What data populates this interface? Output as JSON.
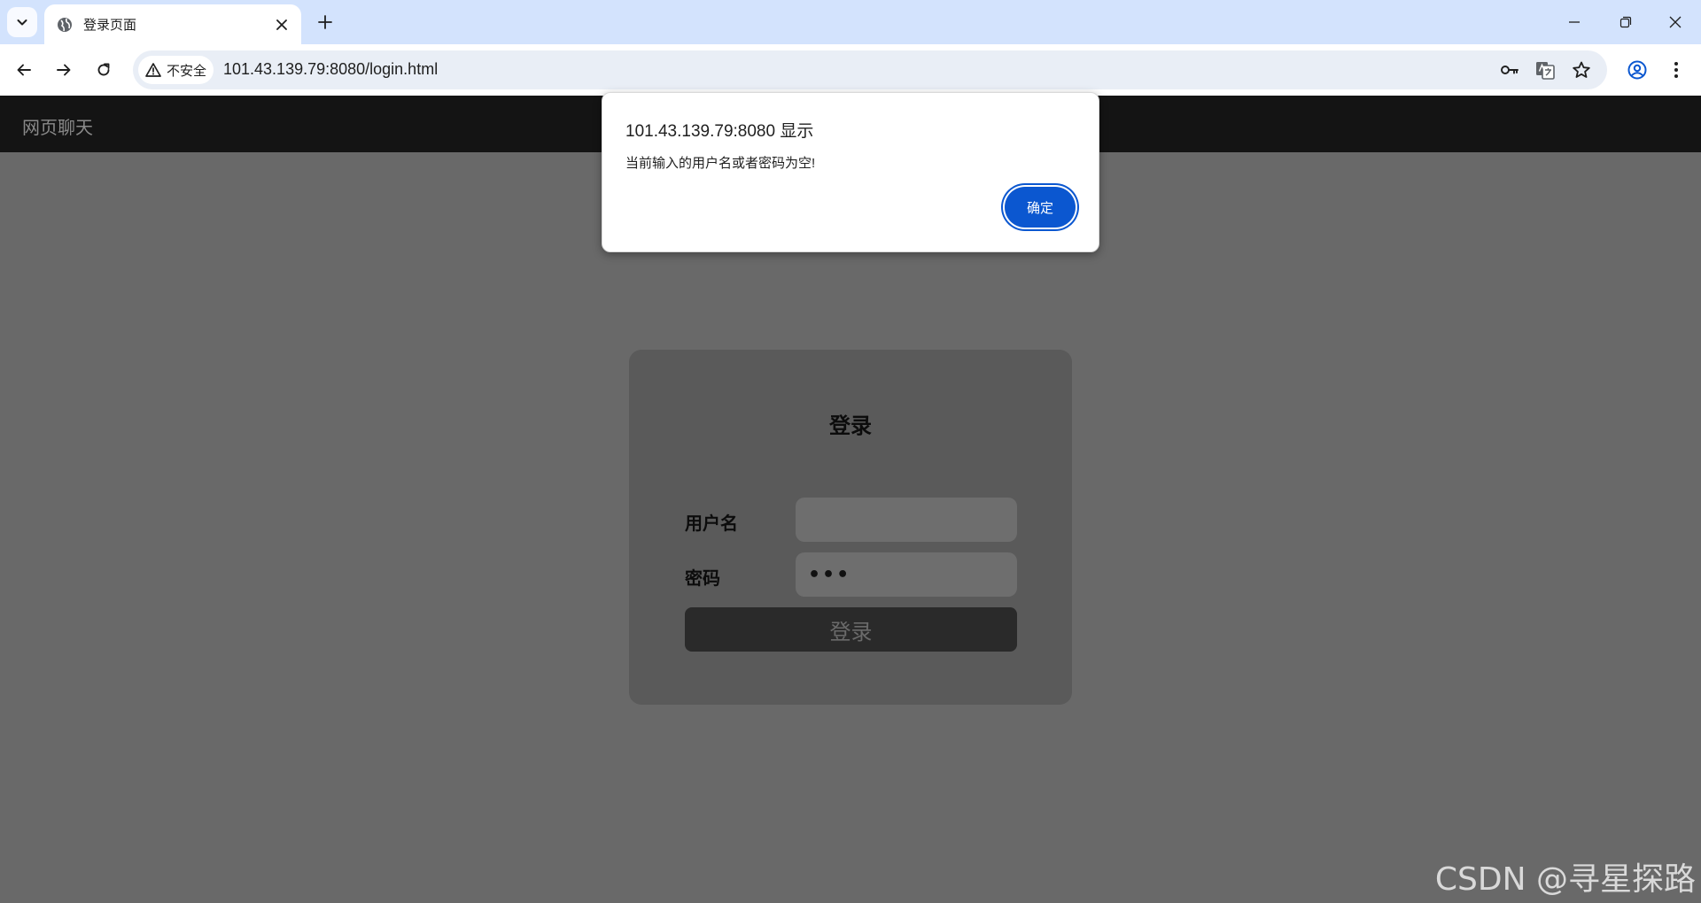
{
  "browser": {
    "tab": {
      "title": "登录页面"
    },
    "omnibox": {
      "security_label": "不安全",
      "url": "101.43.139.79:8080/login.html"
    }
  },
  "page": {
    "nav_title": "网页聊天",
    "login": {
      "heading": "登录",
      "username_label": "用户名",
      "username_value": "",
      "password_label": "密码",
      "password_value": "•••",
      "submit_label": "登录"
    }
  },
  "dialog": {
    "title": "101.43.139.79:8080 显示",
    "message": "当前输入的用户名或者密码为空!",
    "ok_label": "确定"
  },
  "watermark": "CSDN @寻星探路",
  "colors": {
    "tabstrip": "#d3e3fd",
    "accent": "#0b57d0",
    "page_nav": "#141414",
    "page_bg": "#696969",
    "card_bg": "#5a5a5a"
  }
}
